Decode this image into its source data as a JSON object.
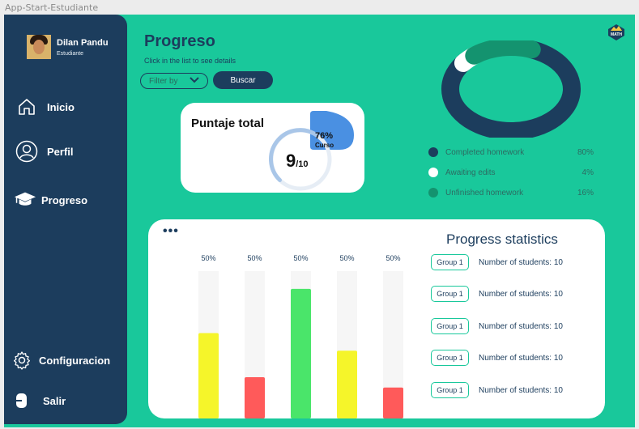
{
  "frame_label": "App-Start-Estudiante",
  "profile": {
    "name": "Dilan Pandu",
    "role": "Estudiante"
  },
  "nav": {
    "inicio": "Inicio",
    "perfil": "Perfil",
    "progreso": "Progreso",
    "configuracion": "Configuracion",
    "salir": "Salir"
  },
  "header": {
    "title": "Progreso",
    "subtitle": "Click in the list to see details",
    "filter_label": "Filter by",
    "search_button": "Buscar"
  },
  "logo_text": "MATH",
  "score": {
    "title": "Puntaje total",
    "value": "9",
    "out_of": "/10",
    "badge_percent": "76%",
    "badge_label": "Curso",
    "fraction": 0.9
  },
  "homework_legend": [
    {
      "label": "Completed homework",
      "percent": "80%",
      "color": "#1c3d5d"
    },
    {
      "label": "Awaiting edits",
      "percent": "4%",
      "color": "#ffffff"
    },
    {
      "label": "Unfinished homework",
      "percent": "16%",
      "color": "#14936f"
    }
  ],
  "colors": {
    "background": "#19c89b",
    "sidebar": "#1c3d5d",
    "accent_blue": "#4a90e2"
  },
  "chart_data": {
    "type": "bar",
    "values": [
      50,
      50,
      50,
      50,
      50
    ],
    "data_labels": [
      "50%",
      "50%",
      "50%",
      "50%",
      "50%"
    ],
    "ylim": [
      0,
      100
    ],
    "bar_colors": [
      "#f5f52a",
      "#ff5a5a",
      "#4ae56a",
      "#f5f52a",
      "#ff5a5a"
    ],
    "bar_heights_visual": [
      58,
      28,
      88,
      46,
      21
    ]
  },
  "stats": {
    "title": "Progress statistics",
    "groups": [
      {
        "button": "Group 1",
        "text": "Number of students: 10"
      },
      {
        "button": "Group 1",
        "text": "Number of students: 10"
      },
      {
        "button": "Group 1",
        "text": "Number of students: 10"
      },
      {
        "button": "Group 1",
        "text": "Number of students: 10"
      },
      {
        "button": "Group 1",
        "text": "Number of students: 10"
      }
    ]
  }
}
